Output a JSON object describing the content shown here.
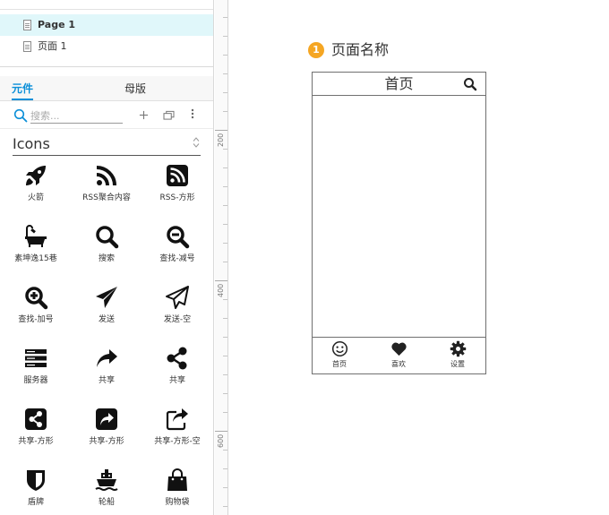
{
  "pages": {
    "items": [
      {
        "label": "Page 1"
      },
      {
        "label": "页面 1"
      }
    ]
  },
  "library": {
    "tabs": [
      "元件",
      "母版"
    ],
    "search_placeholder": "搜索...",
    "selected_library": "Icons",
    "icons": [
      {
        "name": "rocket-icon",
        "label": "火箭"
      },
      {
        "name": "rss-icon",
        "label": "RSS聚合内容"
      },
      {
        "name": "rss-square-icon",
        "label": "RSS-方形"
      },
      {
        "name": "bathtub-icon",
        "label": "素坤逸15巷"
      },
      {
        "name": "search-icon",
        "label": "搜索"
      },
      {
        "name": "search-minus-icon",
        "label": "查找-减号"
      },
      {
        "name": "search-plus-icon",
        "label": "查找-加号"
      },
      {
        "name": "send-icon",
        "label": "发送"
      },
      {
        "name": "send-outline-icon",
        "label": "发送-空"
      },
      {
        "name": "server-icon",
        "label": "服务器"
      },
      {
        "name": "share-arrow-icon",
        "label": "共享"
      },
      {
        "name": "share-nodes-icon",
        "label": "共享"
      },
      {
        "name": "share-square-icon",
        "label": "共享-方形"
      },
      {
        "name": "share-arrow-square-icon",
        "label": "共享-方形"
      },
      {
        "name": "share-square-outline-icon",
        "label": "共享-方形-空"
      },
      {
        "name": "shield-icon",
        "label": "盾牌"
      },
      {
        "name": "ship-icon",
        "label": "轮船"
      },
      {
        "name": "shopping-bag-icon",
        "label": "购物袋"
      }
    ]
  },
  "ruler": {
    "labels": [
      "200",
      "400",
      "600"
    ]
  },
  "canvas": {
    "badge": "1",
    "page_name": "页面名称",
    "phone": {
      "title": "首页",
      "tabbar": [
        {
          "label": "首页",
          "icon": "smile-icon"
        },
        {
          "label": "喜欢",
          "icon": "heart-icon"
        },
        {
          "label": "设置",
          "icon": "gear-icon"
        }
      ]
    }
  }
}
